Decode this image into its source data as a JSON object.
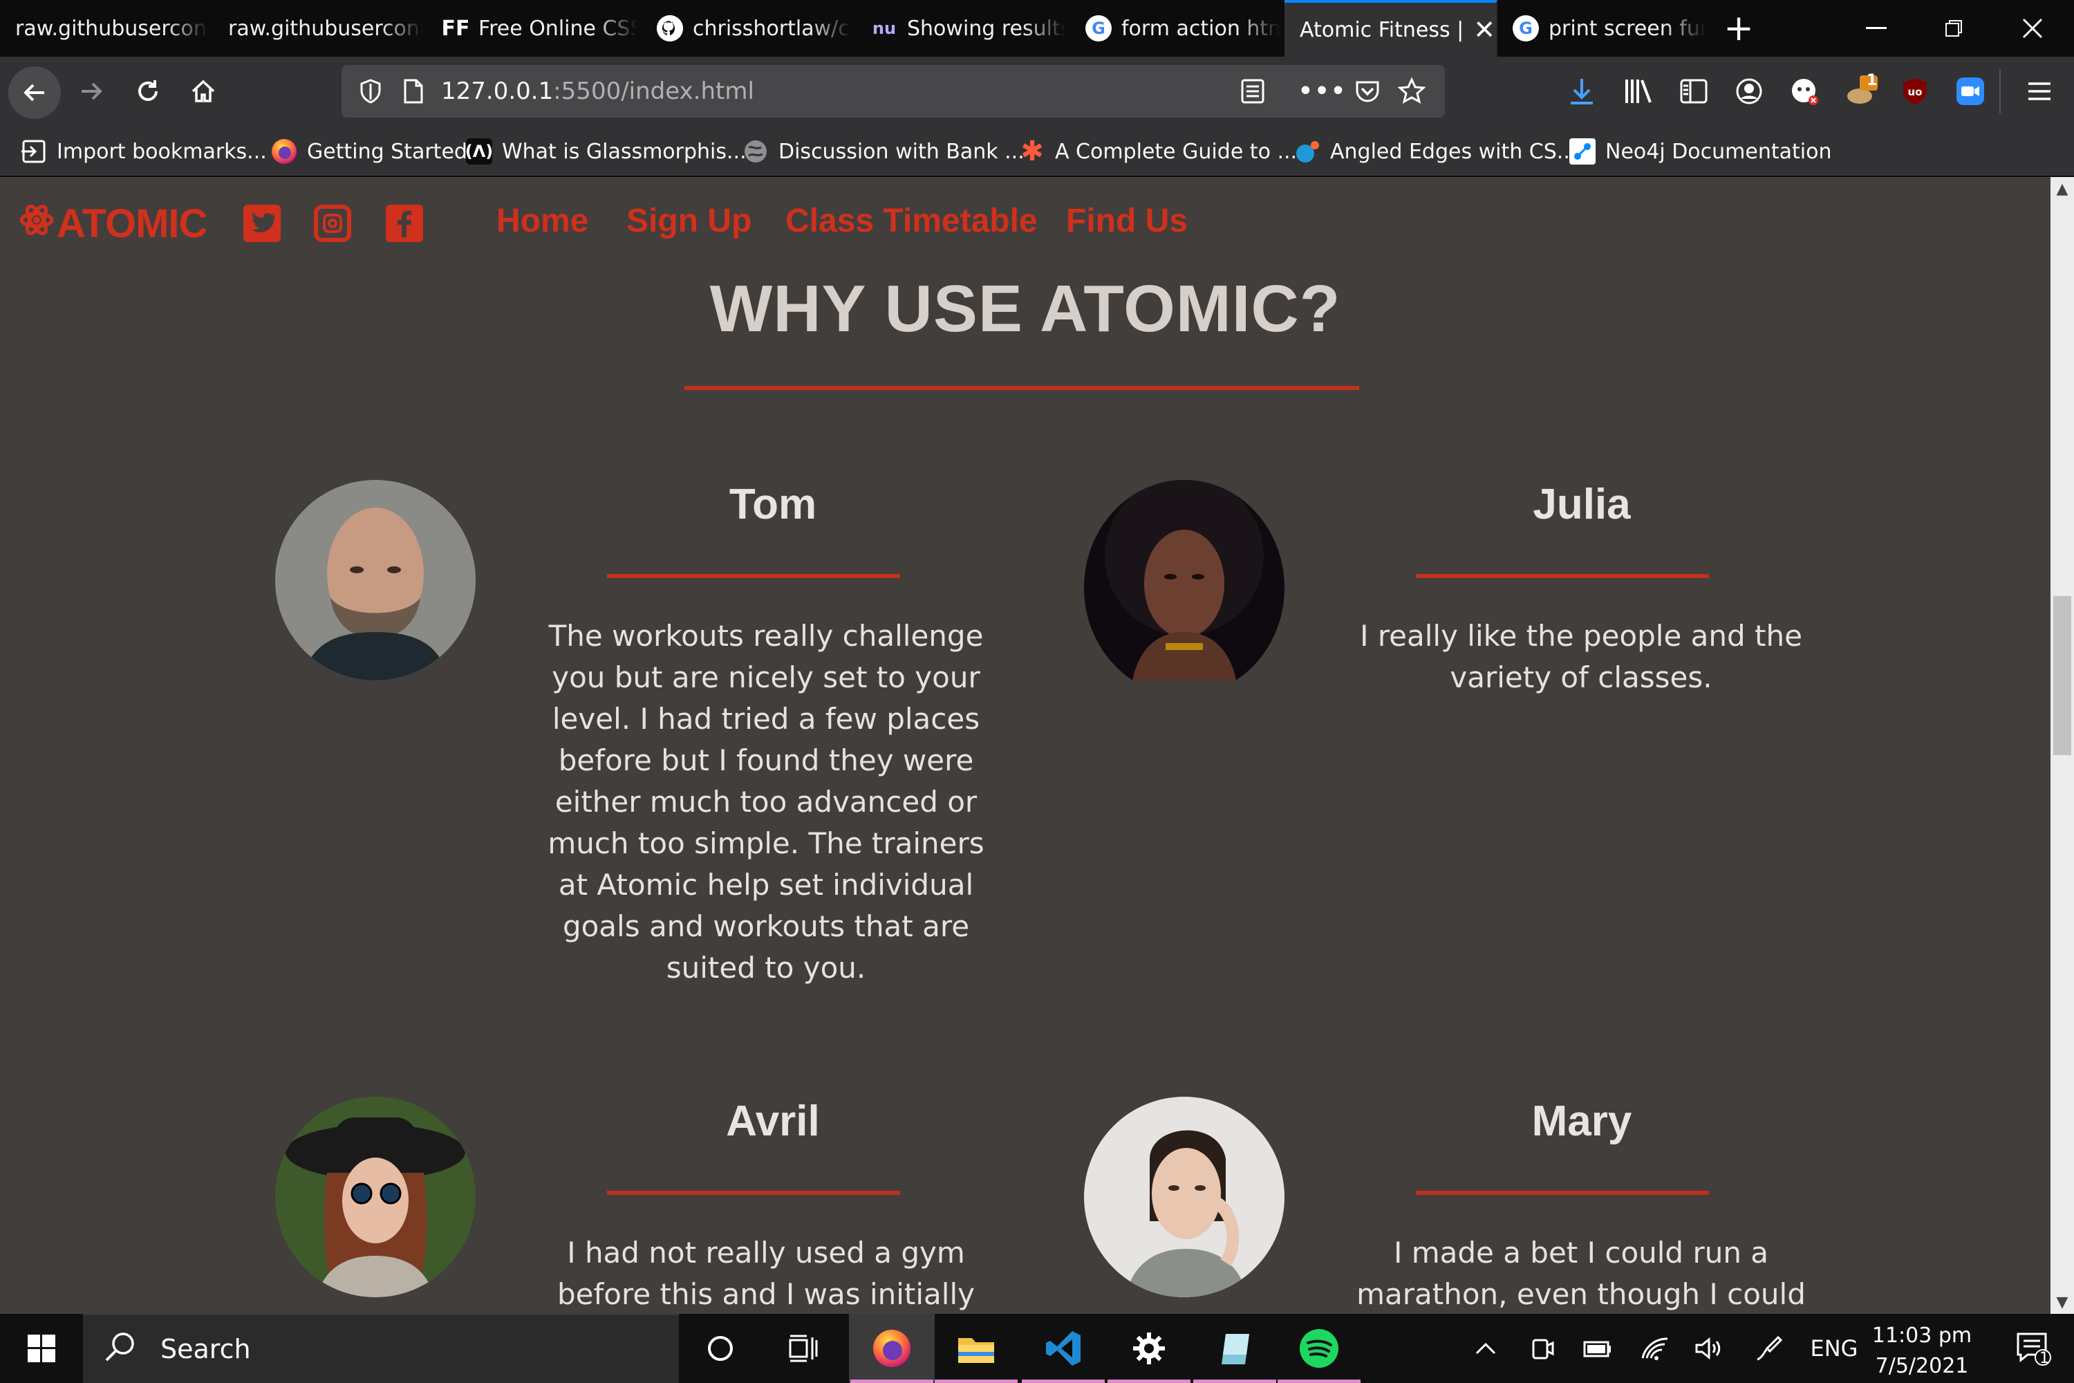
{
  "browser": {
    "tabs": [
      {
        "title": "raw.githubuserconte",
        "icon": "document-icon"
      },
      {
        "title": "raw.githubuserconte",
        "icon": "document-icon"
      },
      {
        "title": "Free Online CSS",
        "icon": "ff-logo-icon",
        "icon_text": "FF"
      },
      {
        "title": "chrisshortlaw/c",
        "icon": "github-icon"
      },
      {
        "title": "Showing results",
        "icon": "nu-icon",
        "icon_text": "nu"
      },
      {
        "title": "form action htm",
        "icon": "google-icon",
        "icon_text": "G"
      },
      {
        "title": "Atomic Fitness |",
        "icon": "",
        "active": true
      },
      {
        "title": "print screen fun",
        "icon": "google-icon",
        "icon_text": "G"
      }
    ],
    "new_tab_glyph": "+",
    "url_host": "127.0.0.1",
    "url_path": ":5500/index.html",
    "bookmarks": [
      {
        "label": "Import bookmarks...",
        "icon": "import-icon"
      },
      {
        "label": "Getting Started",
        "icon": "firefox-icon"
      },
      {
        "label": "What is Glassmorphis...",
        "icon": "code-icon"
      },
      {
        "label": "Discussion with Bank ...",
        "icon": "globe-icon"
      },
      {
        "label": "A Complete Guide to ...",
        "icon": "asterisk-icon"
      },
      {
        "label": "Angled Edges with CS...",
        "icon": "dot-icon"
      },
      {
        "label": "Neo4j Documentation",
        "icon": "neo4j-icon"
      }
    ],
    "badge_count": "1"
  },
  "site": {
    "logo": "ATOMIC",
    "nav": [
      "Home",
      "Sign Up",
      "Class Timetable",
      "Find Us"
    ],
    "section_title": "WHY USE ATOMIC?",
    "testimonials": [
      {
        "name": "Tom",
        "text": "The workouts really challenge you but are nicely set to your level. I had tried a few places before but I found they were either much too advanced or much too simple. The trainers at Atomic help set individual goals and workouts that are suited to you."
      },
      {
        "name": "Julia",
        "text": "I really like the people and the variety of classes."
      },
      {
        "name": "Avril",
        "text": "I had not really used a gym before this and I was initially"
      },
      {
        "name": "Mary",
        "text": "I made a bet I could run a marathon, even though I could"
      }
    ],
    "colors": {
      "accent": "#d0301c",
      "background": "#423e3c",
      "title": "#d6cfca"
    }
  },
  "taskbar": {
    "search_placeholder": "Search",
    "language": "ENG",
    "time": "11:03 pm",
    "date": "7/5/2021",
    "notification_count": "1"
  }
}
